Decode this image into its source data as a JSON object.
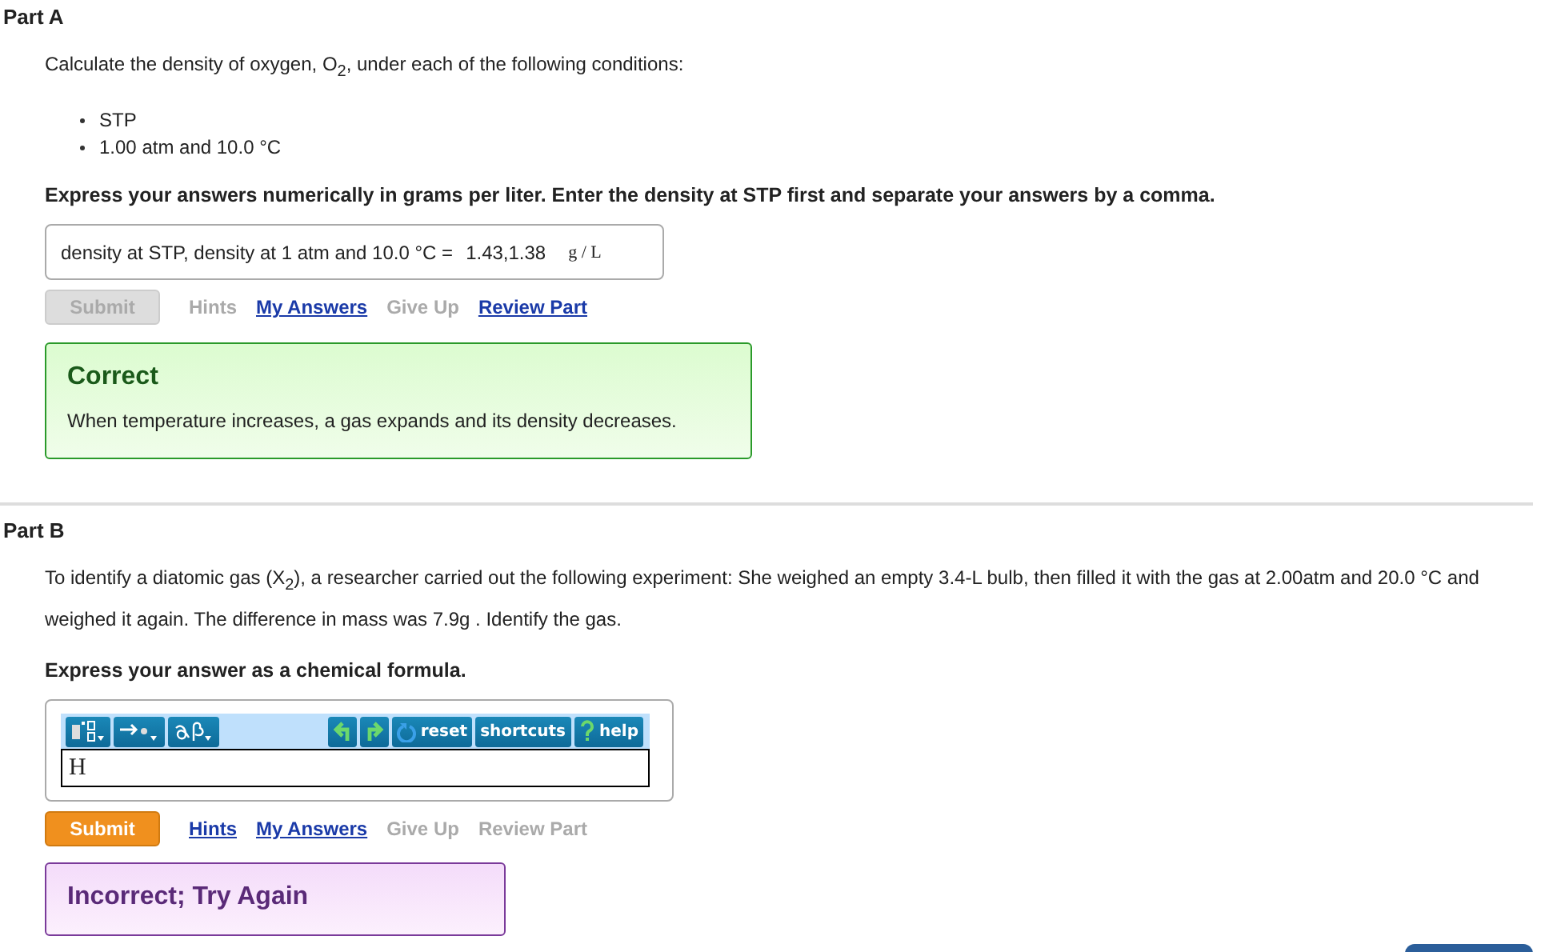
{
  "parts": [
    {
      "title": "Part A",
      "question": "Calculate the density of oxygen, O$_{2}$, under each of the following conditions:",
      "bullets": [
        "STP",
        "1.00 atm and 10.0 °C"
      ],
      "instruction": "Express your answers numerically in grams per liter. Enter the density at STP first and separate your answers by a comma.",
      "answer": {
        "kind": "inline",
        "label": "density at STP, density at 1 atm and 10.0 °C =",
        "value": "1.43,1.38",
        "unit": "g / L"
      },
      "submit": {
        "label": "Submit",
        "disabled": true
      },
      "links": [
        {
          "label": "Hints",
          "disabled": true
        },
        {
          "label": "My Answers",
          "disabled": false
        },
        {
          "label": "Give Up",
          "disabled": true
        },
        {
          "label": "Review Part",
          "disabled": false
        }
      ],
      "feedback": {
        "kind": "correct",
        "title": "Correct",
        "message": "When temperature increases, a gas expands and its density decreases."
      }
    },
    {
      "title": "Part B",
      "question": "To identify a diatomic gas (X$_{2}$), a researcher carried out the following experiment: She weighed an empty 3.4-L bulb, then filled it with the gas at 2.00atm and 20.0 °C and weighed it again. The difference in mass was 7.9g . Identify the gas.",
      "instruction": "Express your answer as a chemical formula.",
      "answer": {
        "kind": "editor",
        "value": "H",
        "tools": [
          "reset",
          "shortcuts",
          "help"
        ]
      },
      "submit": {
        "label": "Submit",
        "disabled": false
      },
      "links": [
        {
          "label": "Hints",
          "disabled": false
        },
        {
          "label": "My Answers",
          "disabled": false
        },
        {
          "label": "Give Up",
          "disabled": true
        },
        {
          "label": "Review Part",
          "disabled": true
        }
      ],
      "feedback": {
        "kind": "incorrect",
        "title": "Incorrect; Try Again"
      }
    }
  ]
}
